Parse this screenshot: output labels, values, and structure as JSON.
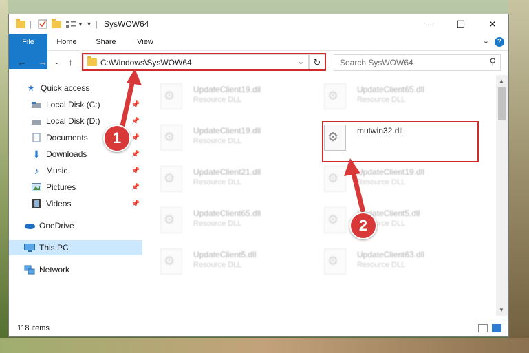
{
  "window": {
    "title": "SysWOW64",
    "tabs": [
      "File",
      "Home",
      "Share",
      "View"
    ],
    "help": "?"
  },
  "address": {
    "path": "C:\\Windows\\SysWOW64",
    "search_placeholder": "Search SysWOW64"
  },
  "nav": {
    "items": [
      {
        "label": "Quick access",
        "icon": "star-icon"
      },
      {
        "label": "Local Disk (C:)",
        "icon": "drive-icon"
      },
      {
        "label": "Local Disk (D:)",
        "icon": "drive-icon"
      },
      {
        "label": "Documents",
        "icon": "documents-icon"
      },
      {
        "label": "Downloads",
        "icon": "download-icon"
      },
      {
        "label": "Music",
        "icon": "music-icon"
      },
      {
        "label": "Pictures",
        "icon": "pictures-icon"
      },
      {
        "label": "Videos",
        "icon": "videos-icon"
      },
      {
        "label": "OneDrive",
        "icon": "cloud-icon"
      },
      {
        "label": "This PC",
        "icon": "computer-icon"
      },
      {
        "label": "Network",
        "icon": "network-icon"
      }
    ]
  },
  "files": [
    {
      "name": "UpdateClient19.dll",
      "type": "Resource DLL"
    },
    {
      "name": "UpdateClient65.dll",
      "type": "Resource DLL"
    },
    {
      "name": "UpdateClient19.dll",
      "type": "Resource DLL"
    },
    {
      "name": "mutwin32.dll",
      "type": ""
    },
    {
      "name": "UpdateClient21.dll",
      "type": "Resource DLL"
    },
    {
      "name": "UpdateClient19.dll",
      "type": "Resource DLL"
    },
    {
      "name": "UpdateClient65.dll",
      "type": "Resource DLL"
    },
    {
      "name": "UpdateClient5.dll",
      "type": "Resource DLL"
    },
    {
      "name": "UpdateClient5.dll",
      "type": "Resource DLL"
    },
    {
      "name": "UpdateClient63.dll",
      "type": "Resource DLL"
    }
  ],
  "status": {
    "item_count": "118 items"
  },
  "callouts": [
    "1",
    "2"
  ],
  "colors": {
    "accent": "#1979ca",
    "annotation": "#d02b2b",
    "selected": "#cce8ff"
  }
}
